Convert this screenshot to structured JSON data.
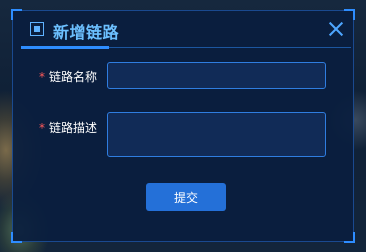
{
  "dialog": {
    "title": "新增链路",
    "icon": "square-icon",
    "close_icon": "close-icon"
  },
  "form": {
    "required_mark": "*",
    "fields": [
      {
        "label": "链路名称",
        "value": "",
        "placeholder": ""
      },
      {
        "label": "链路描述",
        "value": "",
        "placeholder": ""
      }
    ],
    "submit_label": "提交"
  },
  "colors": {
    "accent": "#2e8dff",
    "title": "#6cc0ff",
    "required": "#ff5a5a",
    "button": "#2470d8"
  }
}
